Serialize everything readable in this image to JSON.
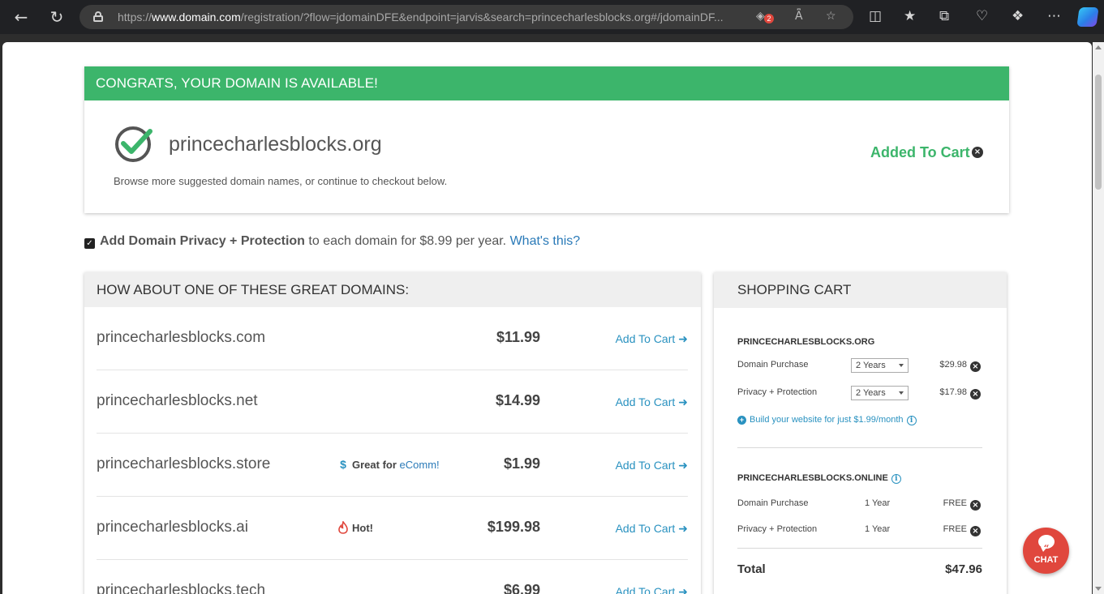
{
  "browser": {
    "url_prefix": "https://",
    "url_host": "www.domain.com",
    "url_rest": "/registration/?flow=jdomainDFE&endpoint=jarvis&search=princecharlesblocks.org#/jdomainDF...",
    "tracker_count": "2",
    "reader_label": "A͆"
  },
  "congrats": {
    "banner": "CONGRATS, YOUR DOMAIN IS AVAILABLE!",
    "domain": "princecharlesblocks.org",
    "subtext": "Browse more suggested domain names, or continue to checkout below.",
    "added_label": "Added To Cart"
  },
  "privacy": {
    "bold_text": "Add Domain Privacy + Protection",
    "rest_text": " to each domain for $8.99 per year. ",
    "link_text": "What's this?",
    "checked": true
  },
  "suggestions": {
    "title": "HOW ABOUT ONE OF THESE GREAT DOMAINS:",
    "add_label": "Add To Cart",
    "rows": [
      {
        "domain": "princecharlesblocks.com",
        "price": "$11.99",
        "tag_prefix": "",
        "tag_accent": ""
      },
      {
        "domain": "princecharlesblocks.net",
        "price": "$14.99",
        "tag_prefix": "",
        "tag_accent": ""
      },
      {
        "domain": "princecharlesblocks.store",
        "price": "$1.99",
        "tag_prefix": "Great for ",
        "tag_accent": "eComm!"
      },
      {
        "domain": "princecharlesblocks.ai",
        "price": "$199.98",
        "tag_prefix": "Hot!",
        "tag_accent": ""
      },
      {
        "domain": "princecharlesblocks.tech",
        "price": "$6.99",
        "tag_prefix": "",
        "tag_accent": ""
      }
    ]
  },
  "cart": {
    "title": "SHOPPING CART",
    "org": {
      "name": "PRINCECHARLESBLOCKS.ORG",
      "items": [
        {
          "label": "Domain Purchase",
          "term": "2 Years",
          "amount": "$29.98"
        },
        {
          "label": "Privacy + Protection",
          "term": "2 Years",
          "amount": "$17.98"
        }
      ],
      "build_link": "Build your website for just $1.99/month"
    },
    "online": {
      "name": "PRINCECHARLESBLOCKS.ONLINE",
      "items": [
        {
          "label": "Domain Purchase",
          "term": "1 Year",
          "amount": "FREE"
        },
        {
          "label": "Privacy + Protection",
          "term": "1 Year",
          "amount": "FREE"
        }
      ]
    },
    "total_label": "Total",
    "total_amount": "$47.96"
  },
  "chat": {
    "label": "CHAT"
  },
  "colors": {
    "brand_green": "#3cb56b",
    "link_blue": "#2a92c0",
    "chat_red": "#e0473d"
  }
}
